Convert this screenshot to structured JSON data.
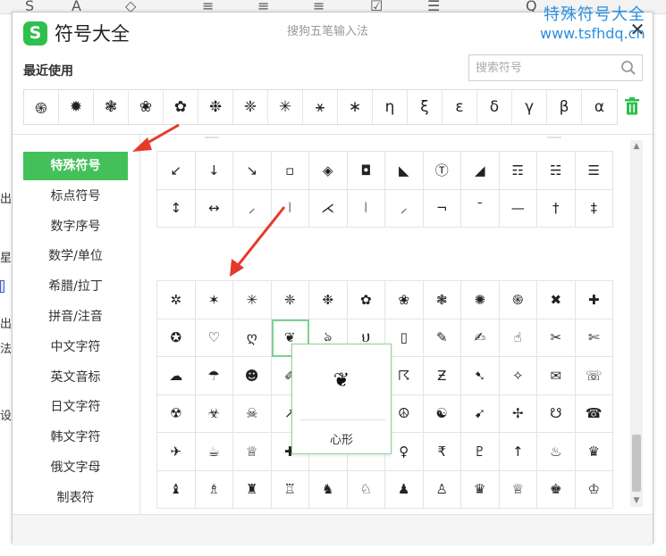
{
  "background": {
    "toolbar_glyphs": [
      "S",
      "A",
      "◇",
      "≡",
      "≡",
      "≡",
      "☑",
      "☰",
      "Q"
    ],
    "side_texts": [
      "出",
      "星",
      "出",
      "法",
      "设"
    ]
  },
  "watermark": {
    "title": "特殊符号大全",
    "url": "www.tsfhdq.cn"
  },
  "dialog": {
    "logo_letter": "S",
    "title": "符号大全",
    "ime_name": "搜狗五笔输入法",
    "close_symbol": "✕",
    "recent_label": "最近使用",
    "search": {
      "placeholder": "搜索符号",
      "value": ""
    },
    "recent_symbols": [
      "֍",
      "✹",
      "❃",
      "❀",
      "✿",
      "❉",
      "❈",
      "✳",
      "⚹",
      "∗",
      "η",
      "ξ",
      "ε",
      "δ",
      "γ",
      "β",
      "α"
    ],
    "sidebar": {
      "items": [
        {
          "label": "特殊符号",
          "active": true
        },
        {
          "label": "标点符号",
          "active": false
        },
        {
          "label": "数字序号",
          "active": false
        },
        {
          "label": "数学/单位",
          "active": false
        },
        {
          "label": "希腊/拉丁",
          "active": false
        },
        {
          "label": "拼音/注音",
          "active": false
        },
        {
          "label": "中文字符",
          "active": false
        },
        {
          "label": "英文音标",
          "active": false
        },
        {
          "label": "日文字符",
          "active": false
        },
        {
          "label": "韩文字符",
          "active": false
        },
        {
          "label": "俄文字母",
          "active": false
        },
        {
          "label": "制表符",
          "active": false
        }
      ]
    },
    "grid_top": [
      [
        "↙",
        "↓",
        "↘",
        "▫",
        "◈",
        "◘",
        "◣",
        "Ⓣ",
        "◢",
        "☶",
        "☵",
        "☰"
      ],
      [
        "↕",
        "↔",
        "⸝",
        "⦚",
        "⋌",
        "⦚",
        "⸝",
        "¬",
        "¯",
        "—",
        "†",
        "‡"
      ]
    ],
    "grid_bottom": [
      [
        "✲",
        "✶",
        "✳",
        "❈",
        "❉",
        "✿",
        "❀",
        "❃",
        "✺",
        "֍",
        "✖",
        "✚"
      ],
      [
        "✪",
        "♡",
        "ღ",
        "❦",
        "ঌ",
        "ህ",
        "▯",
        "✎",
        "✍",
        "☝",
        "✂",
        "✄"
      ],
      [
        "☁",
        "☂",
        "☻",
        "✐",
        "",
        "",
        "☈",
        "Ƶ",
        "➷",
        "✧",
        "✉",
        "☏"
      ],
      [
        "☢",
        "☣",
        "☠",
        "↗",
        "",
        "",
        "☮",
        "☯",
        "➹",
        "✢",
        "☋",
        "☎"
      ],
      [
        "✈",
        "☕",
        "♕",
        "✚",
        "",
        "",
        "♀",
        "₹",
        "♇",
        "↑",
        "♨",
        "♛"
      ],
      [
        "♝",
        "♗",
        "♜",
        "♖",
        "♞",
        "♘",
        "♟",
        "♙",
        "♛",
        "♕",
        "♚",
        "♔"
      ]
    ],
    "preview": {
      "symbol": "❦",
      "label": "心形"
    }
  }
}
